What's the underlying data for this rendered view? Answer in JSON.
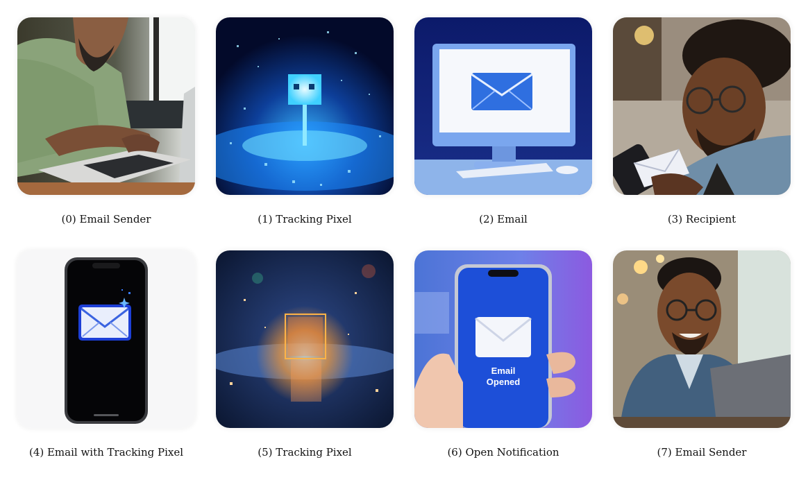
{
  "grid": {
    "items": [
      {
        "index": 0,
        "caption": "(0) Email Sender",
        "icon": "person-typing-laptop"
      },
      {
        "index": 1,
        "caption": "(1) Tracking Pixel",
        "icon": "glowing-blue-pixel-cube"
      },
      {
        "index": 2,
        "caption": "(2) Email",
        "icon": "monitor-with-envelope"
      },
      {
        "index": 3,
        "caption": "(3) Recipient",
        "icon": "man-reading-phone"
      },
      {
        "index": 4,
        "caption": "(4) Email with Tracking Pixel",
        "icon": "phone-with-envelope"
      },
      {
        "index": 5,
        "caption": "(5) Tracking Pixel",
        "icon": "glowing-orange-pixel-cube"
      },
      {
        "index": 6,
        "caption": "(6) Open Notification",
        "icon": "phone-email-opened"
      },
      {
        "index": 7,
        "caption": "(7) Email Sender",
        "icon": "smiling-man-laptop"
      }
    ]
  },
  "phone_screen": {
    "line1": "Email",
    "line2": "Opened"
  }
}
